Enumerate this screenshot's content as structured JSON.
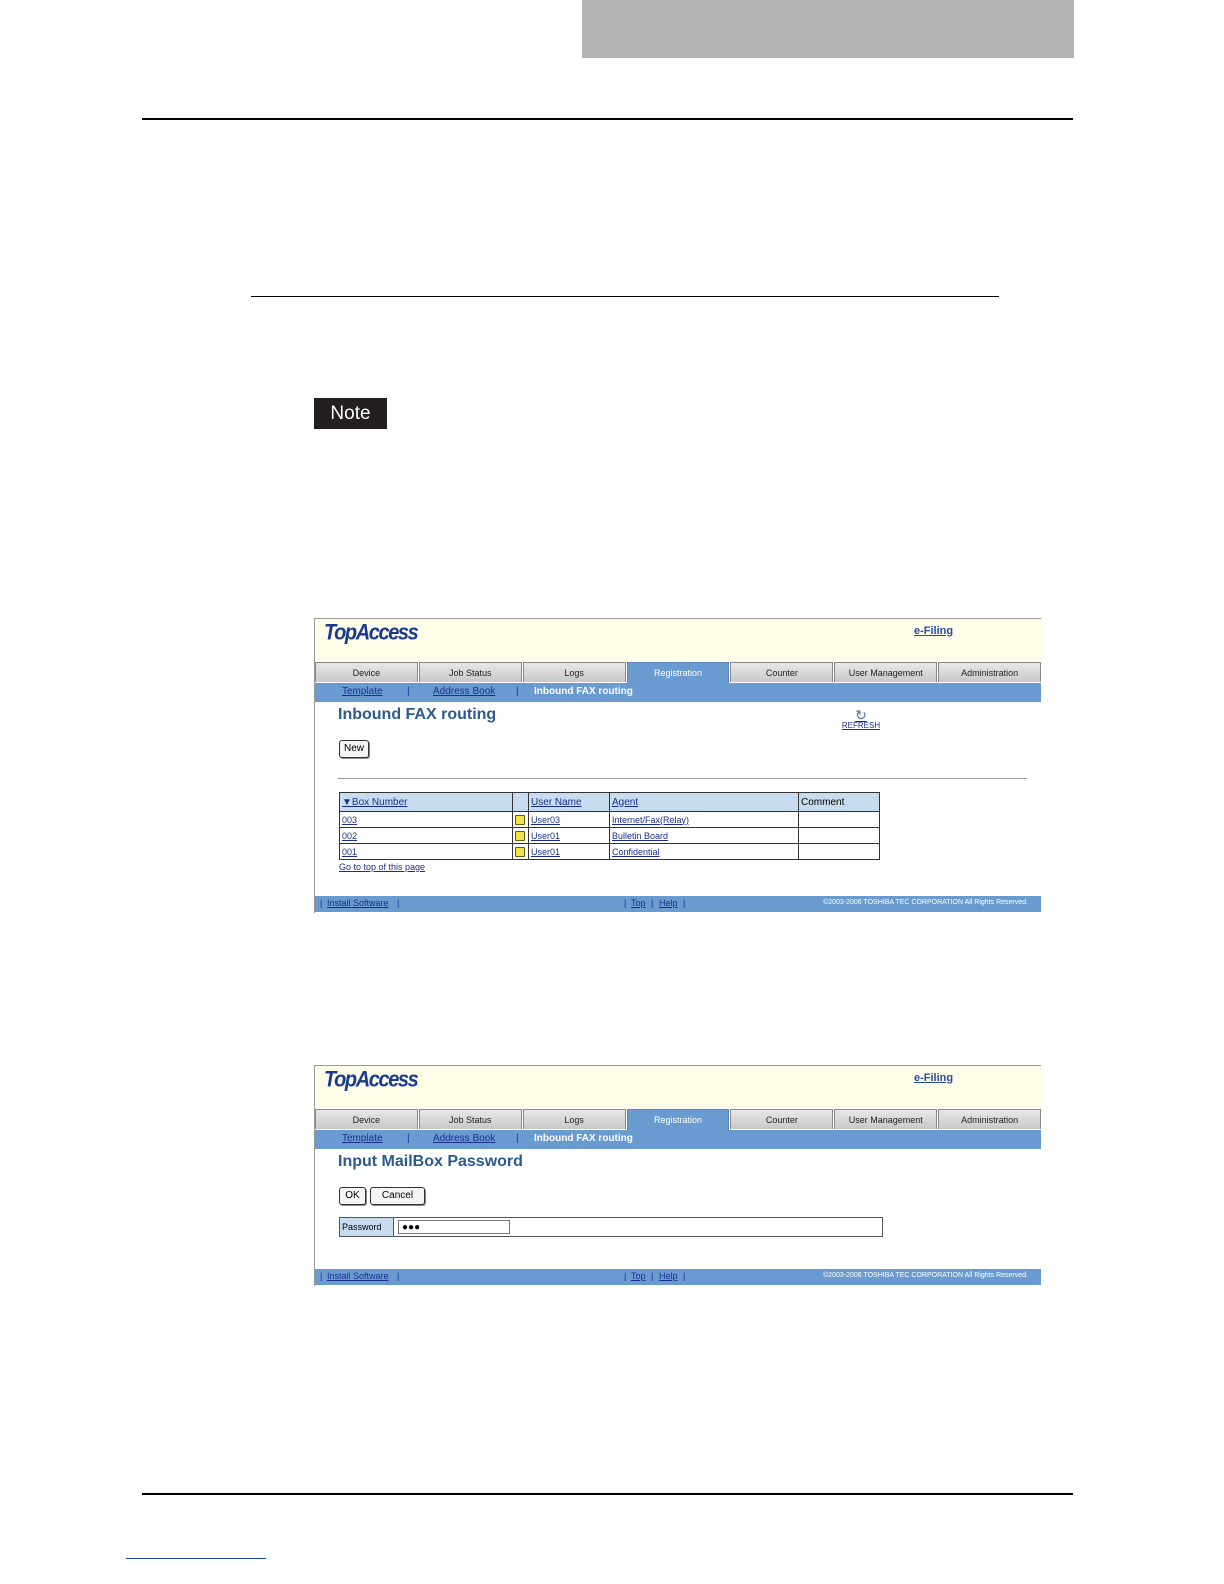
{
  "note": {
    "label": "Note"
  },
  "screen1": {
    "logo": "TopAccess",
    "efiling": "e-Filing",
    "tabs": [
      "Device",
      "Job Status",
      "Logs",
      "Registration",
      "Counter",
      "User Management",
      "Administration"
    ],
    "active_tab": "Registration",
    "subnav": {
      "template": "Template",
      "sep1": "|",
      "address_book": "Address Book",
      "sep2": "|",
      "current": "Inbound FAX routing"
    },
    "title": "Inbound FAX routing",
    "refresh": "REFRESH",
    "new_button": "New",
    "table": {
      "headers": {
        "box_number": "Box Number",
        "user_name": "User Name",
        "agent": "Agent",
        "comment": "Comment"
      },
      "rows": [
        {
          "box": "003",
          "user": "User03",
          "agent": "Internet/Fax(Relay)",
          "comment": ""
        },
        {
          "box": "002",
          "user": "User01",
          "agent": "Bulletin Board",
          "comment": ""
        },
        {
          "box": "001",
          "user": "User01",
          "agent": "Confidential",
          "comment": ""
        }
      ]
    },
    "goto_top": "Go to top of this page",
    "footer": {
      "install": "Install Software",
      "top": "Top",
      "help": "Help",
      "copyright": "©2003-2006 TOSHIBA TEC CORPORATION All Rights Reserved."
    }
  },
  "screen2": {
    "logo": "TopAccess",
    "efiling": "e-Filing",
    "tabs": [
      "Device",
      "Job Status",
      "Logs",
      "Registration",
      "Counter",
      "User Management",
      "Administration"
    ],
    "subnav": {
      "template": "Template",
      "sep1": "|",
      "address_book": "Address Book",
      "sep2": "|",
      "current": "Inbound FAX routing"
    },
    "title": "Input MailBox Password",
    "ok_button": "OK",
    "cancel_button": "Cancel",
    "password_label": "Password",
    "password_value": "●●●",
    "footer": {
      "install": "Install Software",
      "top": "Top",
      "help": "Help",
      "copyright": "©2003-2006 TOSHIBA TEC CORPORATION All Rights Reserved."
    }
  }
}
